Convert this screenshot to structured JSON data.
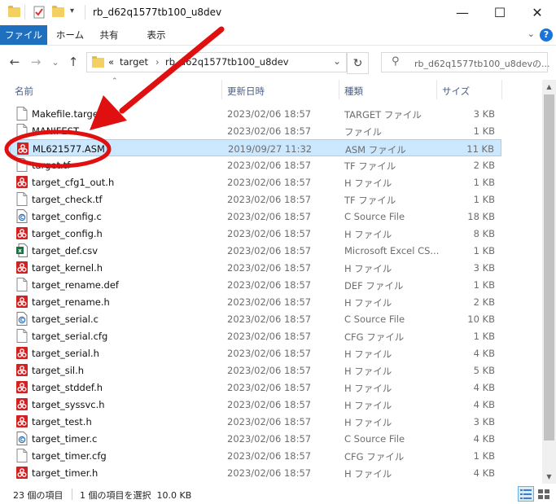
{
  "window": {
    "title": "rb_d62q1577tb100_u8dev",
    "minimize_glyph": "—",
    "maximize_glyph": "☐",
    "close_glyph": "✕"
  },
  "ribbon": {
    "tabs": [
      "ファイル",
      "ホーム",
      "共有",
      "表示"
    ],
    "help_glyph": "?",
    "expand_glyph": "⌄"
  },
  "address": {
    "overflow": "«",
    "crumbs": [
      "target",
      "rb_d62q1577tb100_u8dev"
    ],
    "separator": "›"
  },
  "search": {
    "placeholder": "rb_d62q1577tb100_u8devの..."
  },
  "columns": {
    "name": "名前",
    "date": "更新日時",
    "type": "種類",
    "size": "サイズ"
  },
  "files": [
    {
      "name": "Makefile.target",
      "date": "2023/02/06 18:57",
      "type": "TARGET ファイル",
      "size": "3 KB",
      "icon": "blank-file-icon"
    },
    {
      "name": "MANIFEST",
      "date": "2023/02/06 18:57",
      "type": "ファイル",
      "size": "1 KB",
      "icon": "blank-file-icon"
    },
    {
      "name": "ML621577.ASM",
      "date": "2019/09/27 11:32",
      "type": "ASM ファイル",
      "size": "11 KB",
      "icon": "red-app-icon",
      "selected": true
    },
    {
      "name": "target.tf",
      "date": "2023/02/06 18:57",
      "type": "TF ファイル",
      "size": "2 KB",
      "icon": "blank-file-icon"
    },
    {
      "name": "target_cfg1_out.h",
      "date": "2023/02/06 18:57",
      "type": "H ファイル",
      "size": "1 KB",
      "icon": "red-app-icon"
    },
    {
      "name": "target_check.tf",
      "date": "2023/02/06 18:57",
      "type": "TF ファイル",
      "size": "1 KB",
      "icon": "blank-file-icon"
    },
    {
      "name": "target_config.c",
      "date": "2023/02/06 18:57",
      "type": "C Source File",
      "size": "18 KB",
      "icon": "c-source-icon"
    },
    {
      "name": "target_config.h",
      "date": "2023/02/06 18:57",
      "type": "H ファイル",
      "size": "8 KB",
      "icon": "red-app-icon"
    },
    {
      "name": "target_def.csv",
      "date": "2023/02/06 18:57",
      "type": "Microsoft Excel CS...",
      "size": "1 KB",
      "icon": "excel-icon"
    },
    {
      "name": "target_kernel.h",
      "date": "2023/02/06 18:57",
      "type": "H ファイル",
      "size": "3 KB",
      "icon": "red-app-icon"
    },
    {
      "name": "target_rename.def",
      "date": "2023/02/06 18:57",
      "type": "DEF ファイル",
      "size": "1 KB",
      "icon": "blank-file-icon"
    },
    {
      "name": "target_rename.h",
      "date": "2023/02/06 18:57",
      "type": "H ファイル",
      "size": "2 KB",
      "icon": "red-app-icon"
    },
    {
      "name": "target_serial.c",
      "date": "2023/02/06 18:57",
      "type": "C Source File",
      "size": "10 KB",
      "icon": "c-source-icon"
    },
    {
      "name": "target_serial.cfg",
      "date": "2023/02/06 18:57",
      "type": "CFG ファイル",
      "size": "1 KB",
      "icon": "blank-file-icon"
    },
    {
      "name": "target_serial.h",
      "date": "2023/02/06 18:57",
      "type": "H ファイル",
      "size": "4 KB",
      "icon": "red-app-icon"
    },
    {
      "name": "target_sil.h",
      "date": "2023/02/06 18:57",
      "type": "H ファイル",
      "size": "5 KB",
      "icon": "red-app-icon"
    },
    {
      "name": "target_stddef.h",
      "date": "2023/02/06 18:57",
      "type": "H ファイル",
      "size": "4 KB",
      "icon": "red-app-icon"
    },
    {
      "name": "target_syssvc.h",
      "date": "2023/02/06 18:57",
      "type": "H ファイル",
      "size": "4 KB",
      "icon": "red-app-icon"
    },
    {
      "name": "target_test.h",
      "date": "2023/02/06 18:57",
      "type": "H ファイル",
      "size": "3 KB",
      "icon": "red-app-icon"
    },
    {
      "name": "target_timer.c",
      "date": "2023/02/06 18:57",
      "type": "C Source File",
      "size": "4 KB",
      "icon": "c-source-icon"
    },
    {
      "name": "target_timer.cfg",
      "date": "2023/02/06 18:57",
      "type": "CFG ファイル",
      "size": "1 KB",
      "icon": "blank-file-icon"
    },
    {
      "name": "target_timer.h",
      "date": "2023/02/06 18:57",
      "type": "H ファイル",
      "size": "4 KB",
      "icon": "red-app-icon"
    }
  ],
  "status": {
    "count": "23 個の項目",
    "selection": "1 個の項目を選択  10.0 KB"
  },
  "colors": {
    "accent": "#1f6fbf",
    "selection_bg": "#cce8ff",
    "annotation_red": "#e01010"
  },
  "icons": {
    "back": "←",
    "forward": "→",
    "recent": "⌄",
    "up": "↑",
    "refresh": "↻",
    "search": "⚲",
    "address_dropdown": "⌄",
    "sort_up": "⌃",
    "scroll_up": "▲",
    "scroll_down": "▼"
  }
}
